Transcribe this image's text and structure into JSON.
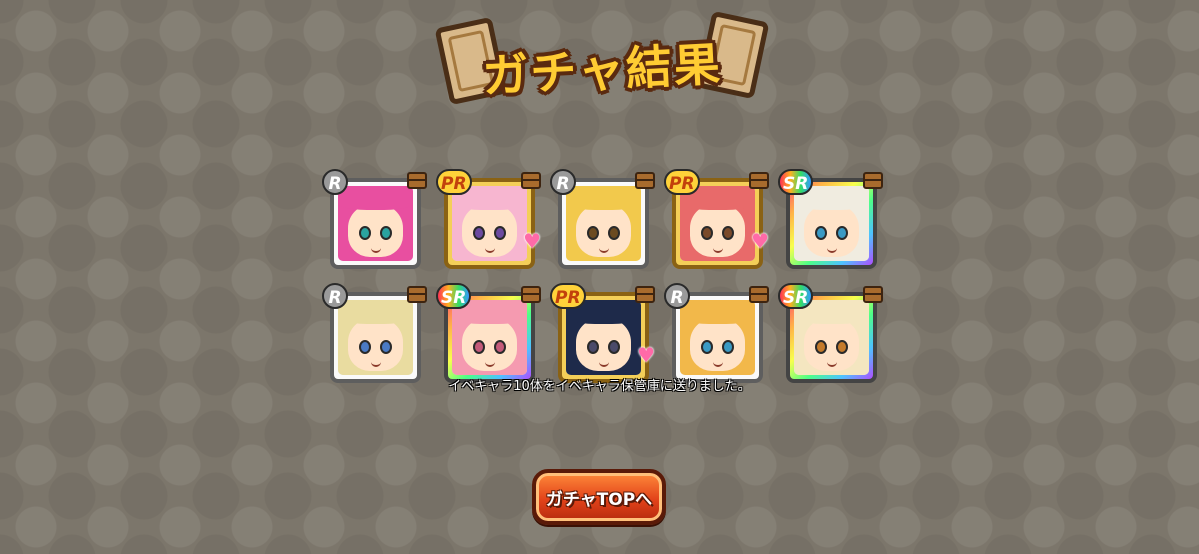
{
  "title": "ガチャ結果",
  "notice": "イベキャラ10体をイベキャラ保管庫に送りました。",
  "button_label": "ガチャTOPへ",
  "cards": [
    {
      "rarity": "R",
      "hair": "#e84fa0",
      "eye": "#2aa3a0",
      "heart": false
    },
    {
      "rarity": "PR",
      "hair": "#f7b6d0",
      "eye": "#6b4aa0",
      "heart": true
    },
    {
      "rarity": "R",
      "hair": "#f2c94c",
      "eye": "#6b4a20",
      "heart": false
    },
    {
      "rarity": "PR",
      "hair": "#e86a6a",
      "eye": "#7a4a2a",
      "heart": true
    },
    {
      "rarity": "SR",
      "hair": "#f0ece0",
      "eye": "#3a9ac4",
      "heart": false
    },
    {
      "rarity": "R",
      "hair": "#e9dca0",
      "eye": "#4a7ac4",
      "heart": false
    },
    {
      "rarity": "SR",
      "hair": "#f59ab0",
      "eye": "#c45a7a",
      "heart": false
    },
    {
      "rarity": "PR",
      "hair": "#1e2a4a",
      "eye": "#4a4a6a",
      "heart": true
    },
    {
      "rarity": "R",
      "hair": "#f2b84a",
      "eye": "#3a9ac4",
      "heart": false
    },
    {
      "rarity": "SR",
      "hair": "#f4e6c0",
      "eye": "#c47a2a",
      "heart": false
    }
  ]
}
